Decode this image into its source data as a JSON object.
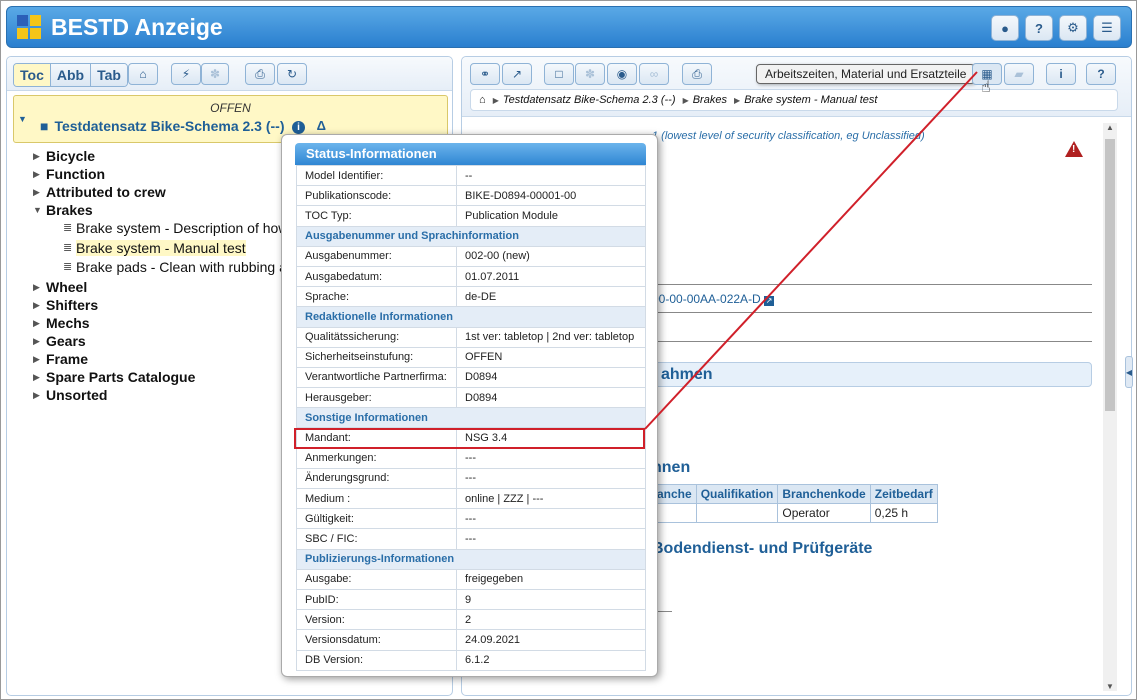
{
  "header": {
    "title": "BESTD Anzeige",
    "buttons": [
      "user-icon",
      "help-icon",
      "gear-icon",
      "menu-icon"
    ]
  },
  "left": {
    "tabs": [
      {
        "label": "Toc",
        "active": true
      },
      {
        "label": "Abb",
        "active": false
      },
      {
        "label": "Tab",
        "active": false
      }
    ],
    "doc": {
      "status": "OFFEN",
      "title": "Testdatensatz Bike-Schema 2.3 (--)",
      "delta": "Δ"
    },
    "tree": [
      {
        "label": "Bicycle",
        "expanded": false
      },
      {
        "label": "Function",
        "expanded": false
      },
      {
        "label": "Attributed to crew",
        "expanded": false
      },
      {
        "label": "Brakes",
        "expanded": true,
        "children": [
          {
            "label": "Brake system - Description of how it works",
            "selected": false
          },
          {
            "label": "Brake system - Manual test",
            "selected": true
          },
          {
            "label": "Brake pads - Clean with rubbing alcohol",
            "selected": false
          }
        ]
      },
      {
        "label": "Wheel",
        "expanded": false
      },
      {
        "label": "Shifters",
        "expanded": false
      },
      {
        "label": "Mechs",
        "expanded": false
      },
      {
        "label": "Gears",
        "expanded": false
      },
      {
        "label": "Frame",
        "expanded": false
      },
      {
        "label": "Spare Parts Catalogue",
        "expanded": false
      },
      {
        "label": "Unsorted",
        "expanded": false
      }
    ]
  },
  "right": {
    "tooltip": "Arbeitszeiten, Material und Ersatzteile",
    "breadcrumb": [
      "Testdatensatz Bike-Schema 2.3 (--)",
      "Brakes",
      "Brake system - Manual test"
    ],
    "security_text": "1 (lowest level of security classification, eg Unclassified)",
    "dm_code": "00-00-00AA-022A-D",
    "section_heading": "ahmen",
    "sub_heading_1": "hnen",
    "sub_heading_2": "Bodendienst- und Prüfgeräte",
    "table": {
      "headers": [
        "anche",
        "Qualifikation",
        "Branchenkode",
        "Zeitbedarf"
      ],
      "row": [
        "",
        "",
        "Operator",
        "0,25 h"
      ]
    }
  },
  "popup": {
    "title": "Status-Informationen",
    "rows": [
      {
        "type": "row",
        "label": "Model Identifier:",
        "value": "--"
      },
      {
        "type": "row",
        "label": "Publikationscode:",
        "value": "BIKE-D0894-00001-00"
      },
      {
        "type": "row",
        "label": "TOC Typ:",
        "value": "Publication Module"
      },
      {
        "type": "section",
        "label": "Ausgabenummer und Sprachinformation"
      },
      {
        "type": "row",
        "label": "Ausgabenummer:",
        "value": "002-00 (new)"
      },
      {
        "type": "row",
        "label": "Ausgabedatum:",
        "value": "01.07.2011"
      },
      {
        "type": "row",
        "label": "Sprache:",
        "value": "de-DE"
      },
      {
        "type": "section",
        "label": "Redaktionelle Informationen"
      },
      {
        "type": "row",
        "label": "Qualitätssicherung:",
        "value": "1st ver: tabletop | 2nd ver: tabletop"
      },
      {
        "type": "row",
        "label": "Sicherheitseinstufung:",
        "value": "OFFEN"
      },
      {
        "type": "row",
        "label": "Verantwortliche Partnerfirma:",
        "value": "D0894"
      },
      {
        "type": "row",
        "label": "Herausgeber:",
        "value": "D0894"
      },
      {
        "type": "section",
        "label": "Sonstige Informationen"
      },
      {
        "type": "row",
        "label": "Mandant:",
        "value": "NSG 3.4",
        "highlight": true
      },
      {
        "type": "row",
        "label": "Anmerkungen:",
        "value": "---"
      },
      {
        "type": "row",
        "label": "Änderungsgrund:",
        "value": "---"
      },
      {
        "type": "row",
        "label": "Medium :",
        "value": "online | ZZZ | ---"
      },
      {
        "type": "row",
        "label": "Gültigkeit:",
        "value": "---"
      },
      {
        "type": "row",
        "label": "SBC / FIC:",
        "value": "---"
      },
      {
        "type": "section",
        "label": "Publizierungs-Informationen"
      },
      {
        "type": "row",
        "label": "Ausgabe:",
        "value": "freigegeben"
      },
      {
        "type": "row",
        "label": "PubID:",
        "value": "9"
      },
      {
        "type": "row",
        "label": "Version:",
        "value": "2"
      },
      {
        "type": "row",
        "label": "Versionsdatum:",
        "value": "24.09.2021"
      },
      {
        "type": "row",
        "label": "DB Version:",
        "value": "6.1.2"
      }
    ]
  },
  "colors": {
    "accent": "#2a7fcf",
    "highlight": "#d0202a",
    "selected": "#fff8c6"
  }
}
